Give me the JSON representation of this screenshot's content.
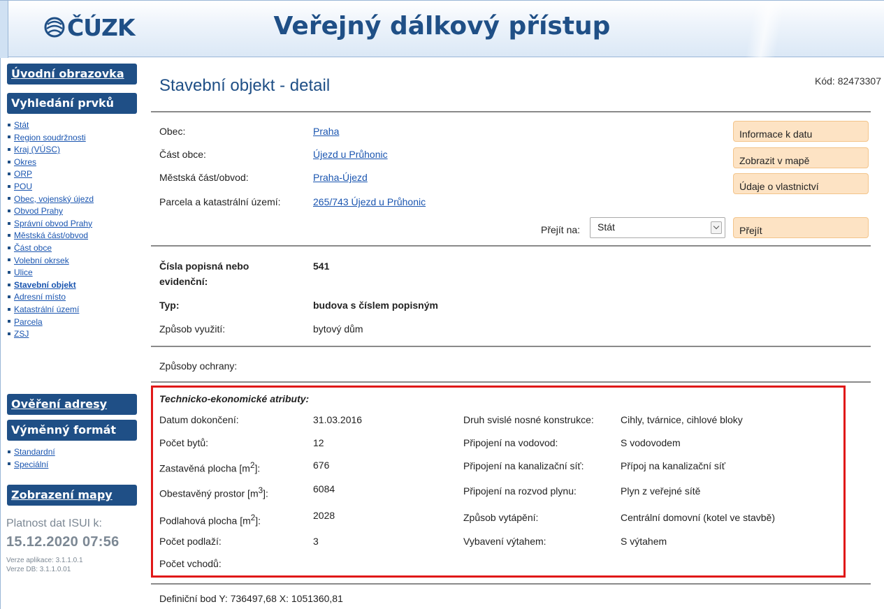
{
  "header": {
    "logo_text": "ČÚZK",
    "title": "Veřejný dálkový přístup"
  },
  "sidebar": {
    "intro": "Úvodní obrazovka",
    "search_heading": "Vyhledání prvků",
    "search_items": [
      {
        "label": "Stát"
      },
      {
        "label": "Region soudržnosti"
      },
      {
        "label": "Kraj (VÚSC)"
      },
      {
        "label": "Okres"
      },
      {
        "label": "ORP"
      },
      {
        "label": "POU"
      },
      {
        "label": "Obec, vojenský újezd"
      },
      {
        "label": "Obvod Prahy"
      },
      {
        "label": "Správní obvod Prahy"
      },
      {
        "label": "Městská část/obvod"
      },
      {
        "label": "Část obce"
      },
      {
        "label": "Volební okrsek"
      },
      {
        "label": "Ulice"
      },
      {
        "label": "Stavební objekt",
        "active": true
      },
      {
        "label": "Adresní místo"
      },
      {
        "label": "Katastrální území"
      },
      {
        "label": "Parcela"
      },
      {
        "label": "ZSJ"
      }
    ],
    "address_check": "Ověření adresy",
    "exchange_heading": "Výměnný formát",
    "exchange_items": [
      {
        "label": "Standardní"
      },
      {
        "label": "Speciální"
      }
    ],
    "map_view": "Zobrazení mapy",
    "validity_label": "Platnost dat ISUI k:",
    "validity_date": "15.12.2020 07:56",
    "app_version": "Verze aplikace: 3.1.1.0.1",
    "db_version": "Verze DB: 3.1.1.0.01"
  },
  "main": {
    "title": "Stavební objekt - detail",
    "code": "Kód: 82473307",
    "location": {
      "obec_label": "Obec:",
      "obec_value": "Praha",
      "cast_obce_label": "Část obce:",
      "cast_obce_value": "Újezd u Průhonic",
      "mestska_cast_label": "Městská část/obvod:",
      "mestska_cast_value": "Praha-Újezd",
      "parcela_label": "Parcela a katastrální území:",
      "parcela_value": "265/743 Újezd u Průhonic"
    },
    "buttons": {
      "info": "Informace k datu",
      "map": "Zobrazit v mapě",
      "ownership": "Údaje o vlastnictví",
      "go": "Přejít"
    },
    "goto": {
      "label": "Přejít na:",
      "selected": "Stát"
    },
    "building": {
      "numbers_label_line1": "Čísla popisná nebo",
      "numbers_label_line2": "evidenční:",
      "numbers_value": "541",
      "type_label": "Typ:",
      "type_value": "budova s číslem popisným",
      "usage_label": "Způsob využití:",
      "usage_value": "bytový dům",
      "protection_label": "Způsoby ochrany:"
    },
    "tech": {
      "title": "Technicko-ekonomické atributy:",
      "completion_label": "Datum dokončení:",
      "completion_value": "31.03.2016",
      "flats_label": "Počet bytů:",
      "flats_value": "12",
      "built_area_label": "Zastavěná plocha [m",
      "built_area_value": "676",
      "volume_label": "Obestavěný prostor [m",
      "volume_value": "6084",
      "floor_area_label": "Podlahová plocha [m",
      "floor_area_value": "2028",
      "floors_label": "Počet podlaží:",
      "floors_value": "3",
      "entrances_label": "Počet vchodů:",
      "construction_label": "Druh svislé nosné konstrukce:",
      "construction_value": "Cihly, tvárnice, cihlové bloky",
      "water_label": "Připojení na vodovod:",
      "water_value": "S vodovodem",
      "sewer_label": "Připojení na kanalizační síť:",
      "sewer_value": "Přípoj na kanalizační síť",
      "gas_label": "Připojení na rozvod plynu:",
      "gas_value": "Plyn z veřejné sítě",
      "heating_label": "Způsob vytápění:",
      "heating_value": "Centrální domovní (kotel ve stavbě)",
      "lift_label": "Vybavení výtahem:",
      "lift_value": "S výtahem"
    },
    "definition_point": "Definiční bod Y: 736497,68 X: 1051360,81"
  }
}
